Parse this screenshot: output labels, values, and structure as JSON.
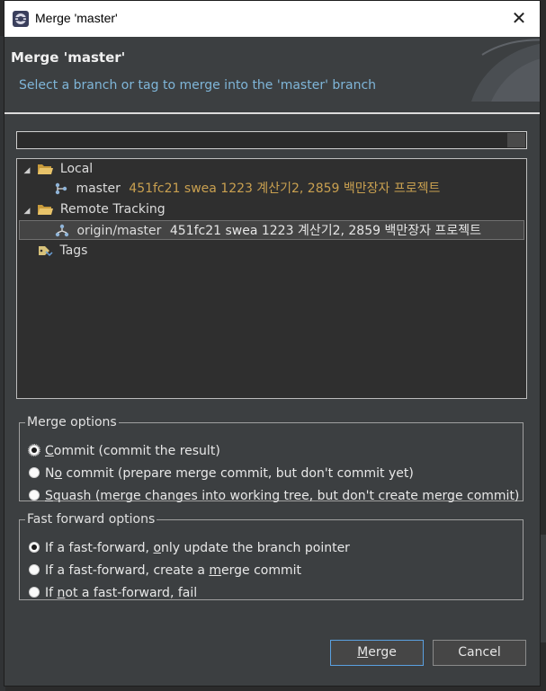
{
  "window": {
    "title": "Merge 'master'",
    "close_glyph": "✕"
  },
  "header": {
    "title": "Merge 'master'",
    "subtitle": "Select a branch or tag to merge into the 'master' branch"
  },
  "filter": {
    "value": "",
    "placeholder": ""
  },
  "tree": {
    "local": {
      "label": "Local",
      "branch": {
        "name": "master",
        "meta": "451fc21 swea 1223 계산기2, 2859 백만장자 프로젝트"
      }
    },
    "remote": {
      "label": "Remote Tracking",
      "branch": {
        "name": "origin/master",
        "meta": "451fc21 swea 1223 계산기2, 2859 백만장자 프로젝트",
        "selected": true
      }
    },
    "tags": {
      "label": "Tags"
    }
  },
  "merge_options": {
    "legend": "Merge options",
    "selected_index": 0,
    "options": [
      {
        "key": "C",
        "rest": "ommit (commit the result)"
      },
      {
        "pre": "N",
        "key": "o",
        "rest": " commit (prepare merge commit, but don't commit yet)"
      },
      {
        "key": "S",
        "rest": "quash (merge changes into working tree, but don't create merge commit)"
      }
    ]
  },
  "ff_options": {
    "legend": "Fast forward options",
    "selected_index": 0,
    "options": [
      {
        "pre": "If a fast-forward, ",
        "key": "o",
        "rest": "nly update the branch pointer"
      },
      {
        "pre": "If a fast-forward, create a ",
        "key": "m",
        "rest": "erge commit"
      },
      {
        "pre": "If ",
        "key": "n",
        "rest": "ot a fast-forward, fail"
      }
    ]
  },
  "buttons": {
    "merge_key": "M",
    "merge_rest": "erge",
    "cancel": "Cancel"
  },
  "colors": {
    "dialog_bg": "#3c3f41",
    "tree_bg": "#2f2f2f",
    "subtitle": "#7fb6d9",
    "commit_meta": "#c9a050",
    "primary_border": "#5aa0e0"
  }
}
